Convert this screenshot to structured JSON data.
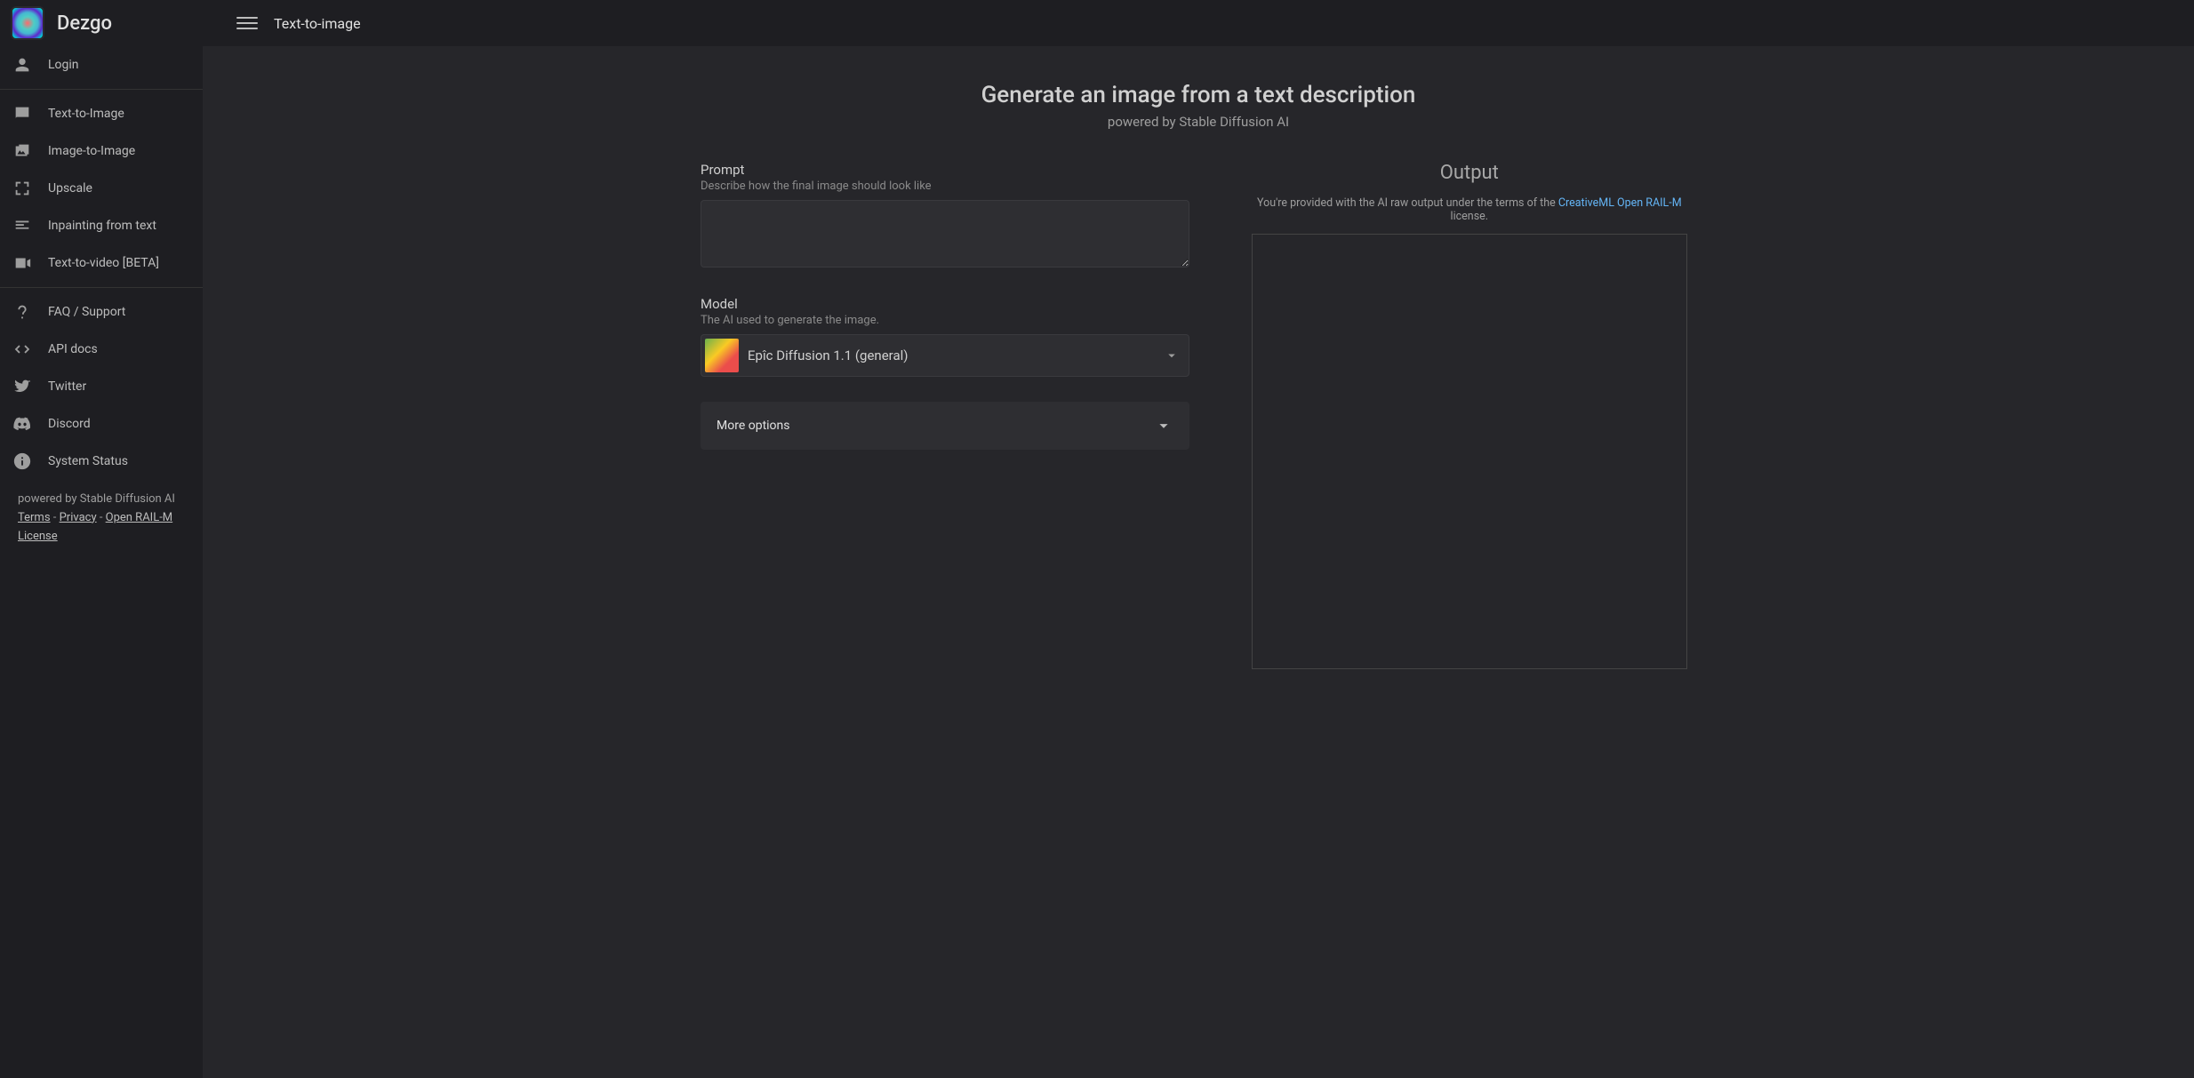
{
  "brand": "Dezgo",
  "page_title": "Text-to-image",
  "sidebar": {
    "login": "Login",
    "nav": [
      {
        "label": "Text-to-Image"
      },
      {
        "label": "Image-to-Image"
      },
      {
        "label": "Upscale"
      },
      {
        "label": "Inpainting from text"
      },
      {
        "label": "Text-to-video [BETA]"
      }
    ],
    "meta": [
      {
        "label": "FAQ / Support"
      },
      {
        "label": "API docs"
      },
      {
        "label": "Twitter"
      },
      {
        "label": "Discord"
      },
      {
        "label": "System Status"
      }
    ],
    "footer": {
      "powered": "powered by Stable Diffusion AI",
      "terms": "Terms",
      "sep1": " - ",
      "privacy": "Privacy",
      "sep2": " - ",
      "license": "Open RAIL-M License"
    }
  },
  "hero": {
    "title": "Generate an image from a text description",
    "subtitle": "powered by Stable Diffusion AI"
  },
  "form": {
    "prompt_label": "Prompt",
    "prompt_desc": "Describe how the final image should look like",
    "prompt_value": "",
    "model_label": "Model",
    "model_desc": "The AI used to generate the image.",
    "model_selected": "Epîc Diffusion 1.1 (general)",
    "more_options": "More options"
  },
  "output": {
    "title": "Output",
    "terms_pre": "You're provided with the AI raw output under the terms of the ",
    "terms_link": "CreativeML Open RAIL-M",
    "terms_post": " license."
  }
}
